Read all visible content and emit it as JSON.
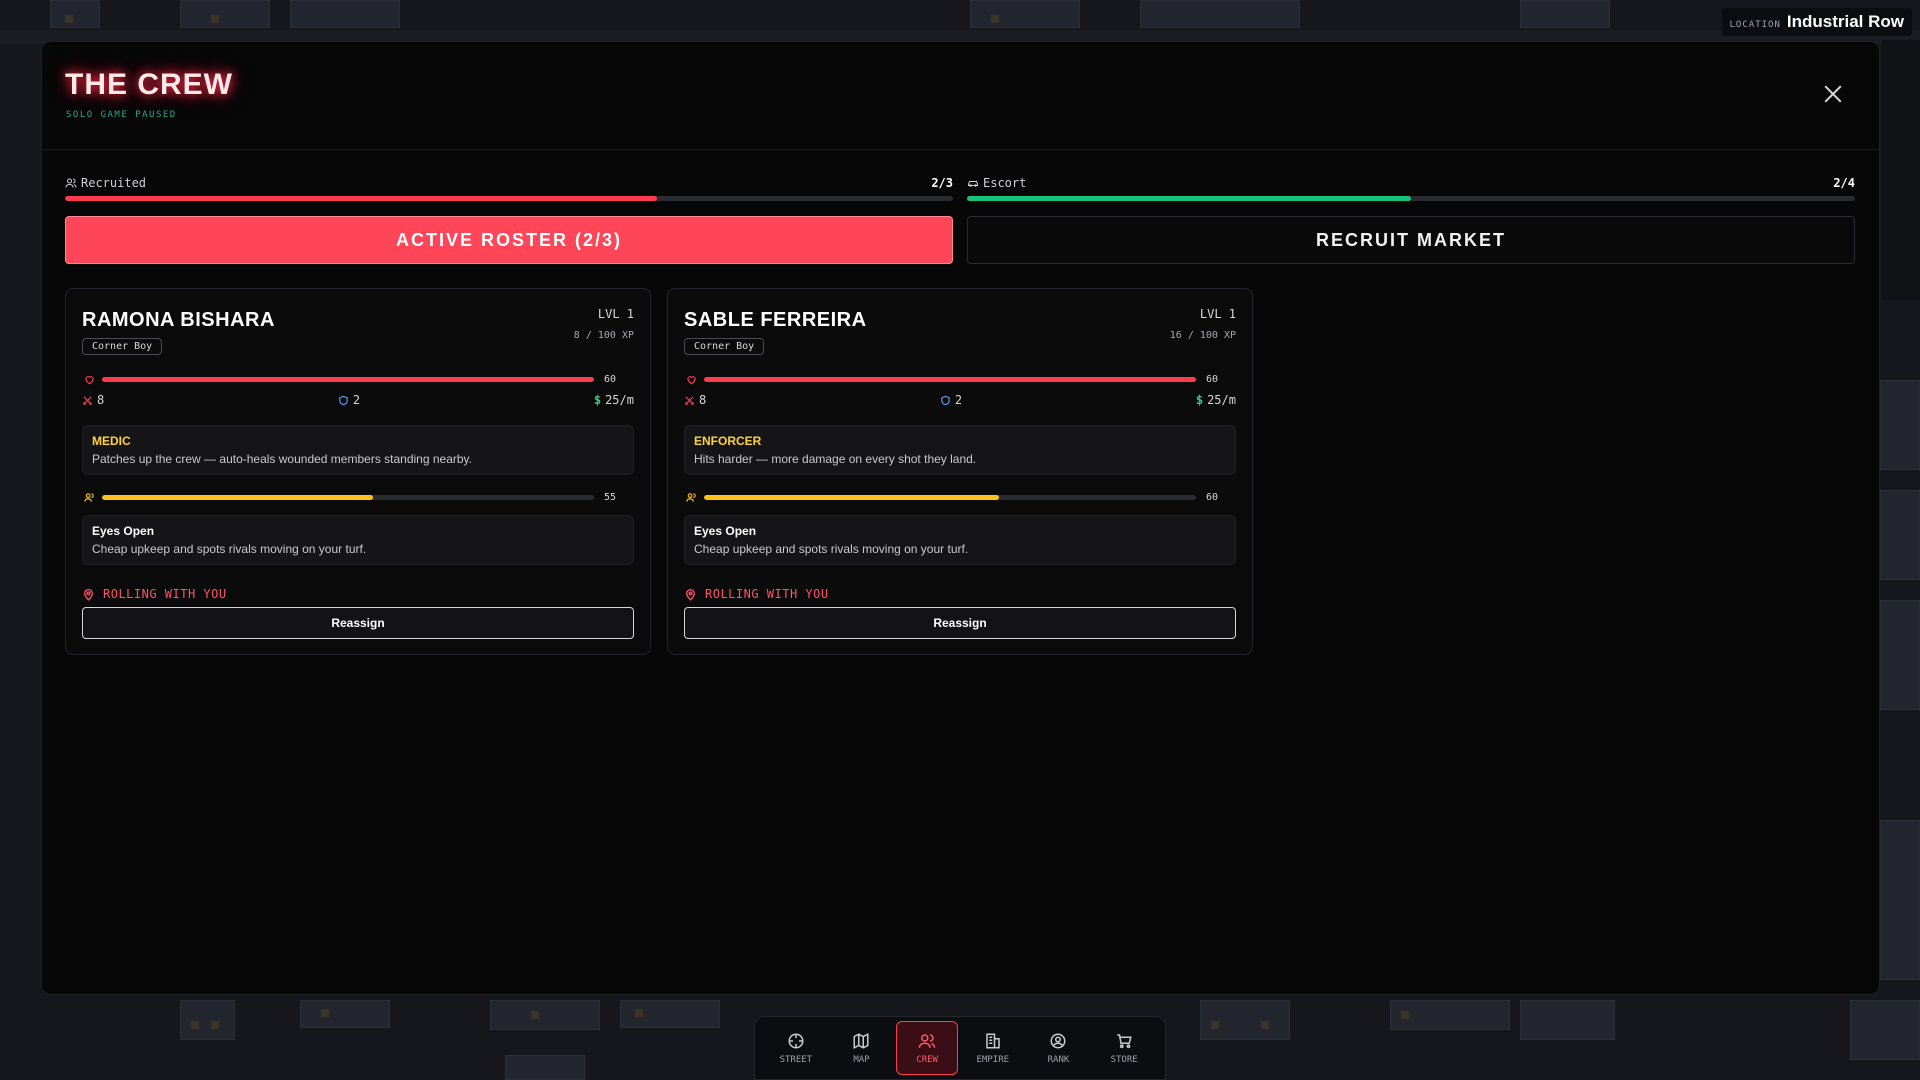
{
  "location": {
    "key": "LOCATION",
    "value": "Industrial Row"
  },
  "modal": {
    "title": "THE CREW",
    "subtitle": "SOLO GAME PAUSED"
  },
  "progress": {
    "recruited": {
      "label": "Recruited",
      "value": "2/3",
      "fraction": 0.667,
      "color": "#ff3b50"
    },
    "escort": {
      "label": "Escort",
      "value": "2/4",
      "fraction": 0.5,
      "color": "#18c37e"
    }
  },
  "tabs": [
    {
      "label": "ACTIVE ROSTER (2/3)",
      "active": true
    },
    {
      "label": "RECRUIT MARKET",
      "active": false
    }
  ],
  "members": [
    {
      "name": "RAMONA BISHARA",
      "level": "LVL 1",
      "xp": "8 / 100 XP",
      "role": "Corner Boy",
      "health": "60",
      "health_fraction": 1.0,
      "attack": "8",
      "defense": "2",
      "wage": "25/m",
      "specialty": {
        "title": "MEDIC",
        "text": "Patches up the crew — auto-heals wounded members standing nearby.",
        "color": "#ffd23a"
      },
      "loyalty": "55",
      "loyalty_fraction": 0.55,
      "trait": {
        "title": "Eyes Open",
        "text": "Cheap upkeep and spots rivals moving on your turf."
      },
      "status": "ROLLING WITH YOU",
      "action": "Reassign"
    },
    {
      "name": "SABLE FERREIRA",
      "level": "LVL 1",
      "xp": "16 / 100 XP",
      "role": "Corner Boy",
      "health": "60",
      "health_fraction": 1.0,
      "attack": "8",
      "defense": "2",
      "wage": "25/m",
      "specialty": {
        "title": "ENFORCER",
        "text": "Hits harder — more damage on every shot they land.",
        "color": "#ffd23a"
      },
      "loyalty": "60",
      "loyalty_fraction": 0.6,
      "trait": {
        "title": "Eyes Open",
        "text": "Cheap upkeep and spots rivals moving on your turf."
      },
      "status": "ROLLING WITH YOU",
      "action": "Reassign"
    }
  ],
  "nav": [
    {
      "label": "STREET",
      "icon": "crosshair-icon",
      "active": false
    },
    {
      "label": "MAP",
      "icon": "map-icon",
      "active": false
    },
    {
      "label": "CREW",
      "icon": "users-icon",
      "active": true
    },
    {
      "label": "EMPIRE",
      "icon": "building-icon",
      "active": false
    },
    {
      "label": "RANK",
      "icon": "user-circle-icon",
      "active": false
    },
    {
      "label": "STORE",
      "icon": "cart-icon",
      "active": false
    }
  ],
  "colors": {
    "accent": "#ff4659",
    "health": "#ff3b50",
    "loyalty": "#ffc21a",
    "escort": "#18c37e",
    "status": "#ff5266"
  }
}
